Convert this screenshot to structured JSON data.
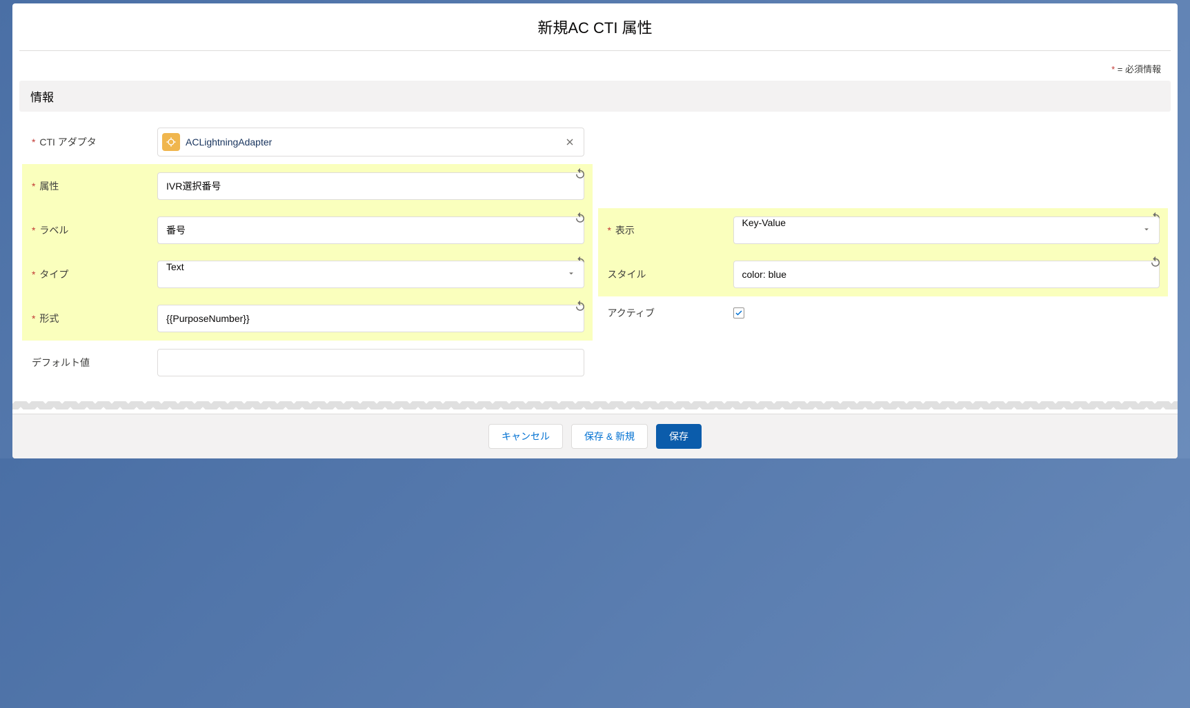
{
  "modal": {
    "title": "新規AC CTI 属性",
    "required_legend": "= 必須情報"
  },
  "section": {
    "info": "情報"
  },
  "fields": {
    "cti_adapter": {
      "label": "CTI アダプタ",
      "value": "ACLightningAdapter"
    },
    "attribute": {
      "label": "属性",
      "value": "IVR選択番号"
    },
    "display_label": {
      "label": "ラベル",
      "value": "番号"
    },
    "type": {
      "label": "タイプ",
      "value": "Text"
    },
    "format": {
      "label": "形式",
      "value": "{{PurposeNumber}}"
    },
    "default_value": {
      "label": "デフォルト値",
      "value": ""
    },
    "display": {
      "label": "表示",
      "value": "Key-Value"
    },
    "style": {
      "label": "スタイル",
      "value": "color: blue"
    },
    "active": {
      "label": "アクティブ",
      "checked": true
    }
  },
  "footer": {
    "cancel": "キャンセル",
    "save_new": "保存 & 新規",
    "save": "保存"
  }
}
